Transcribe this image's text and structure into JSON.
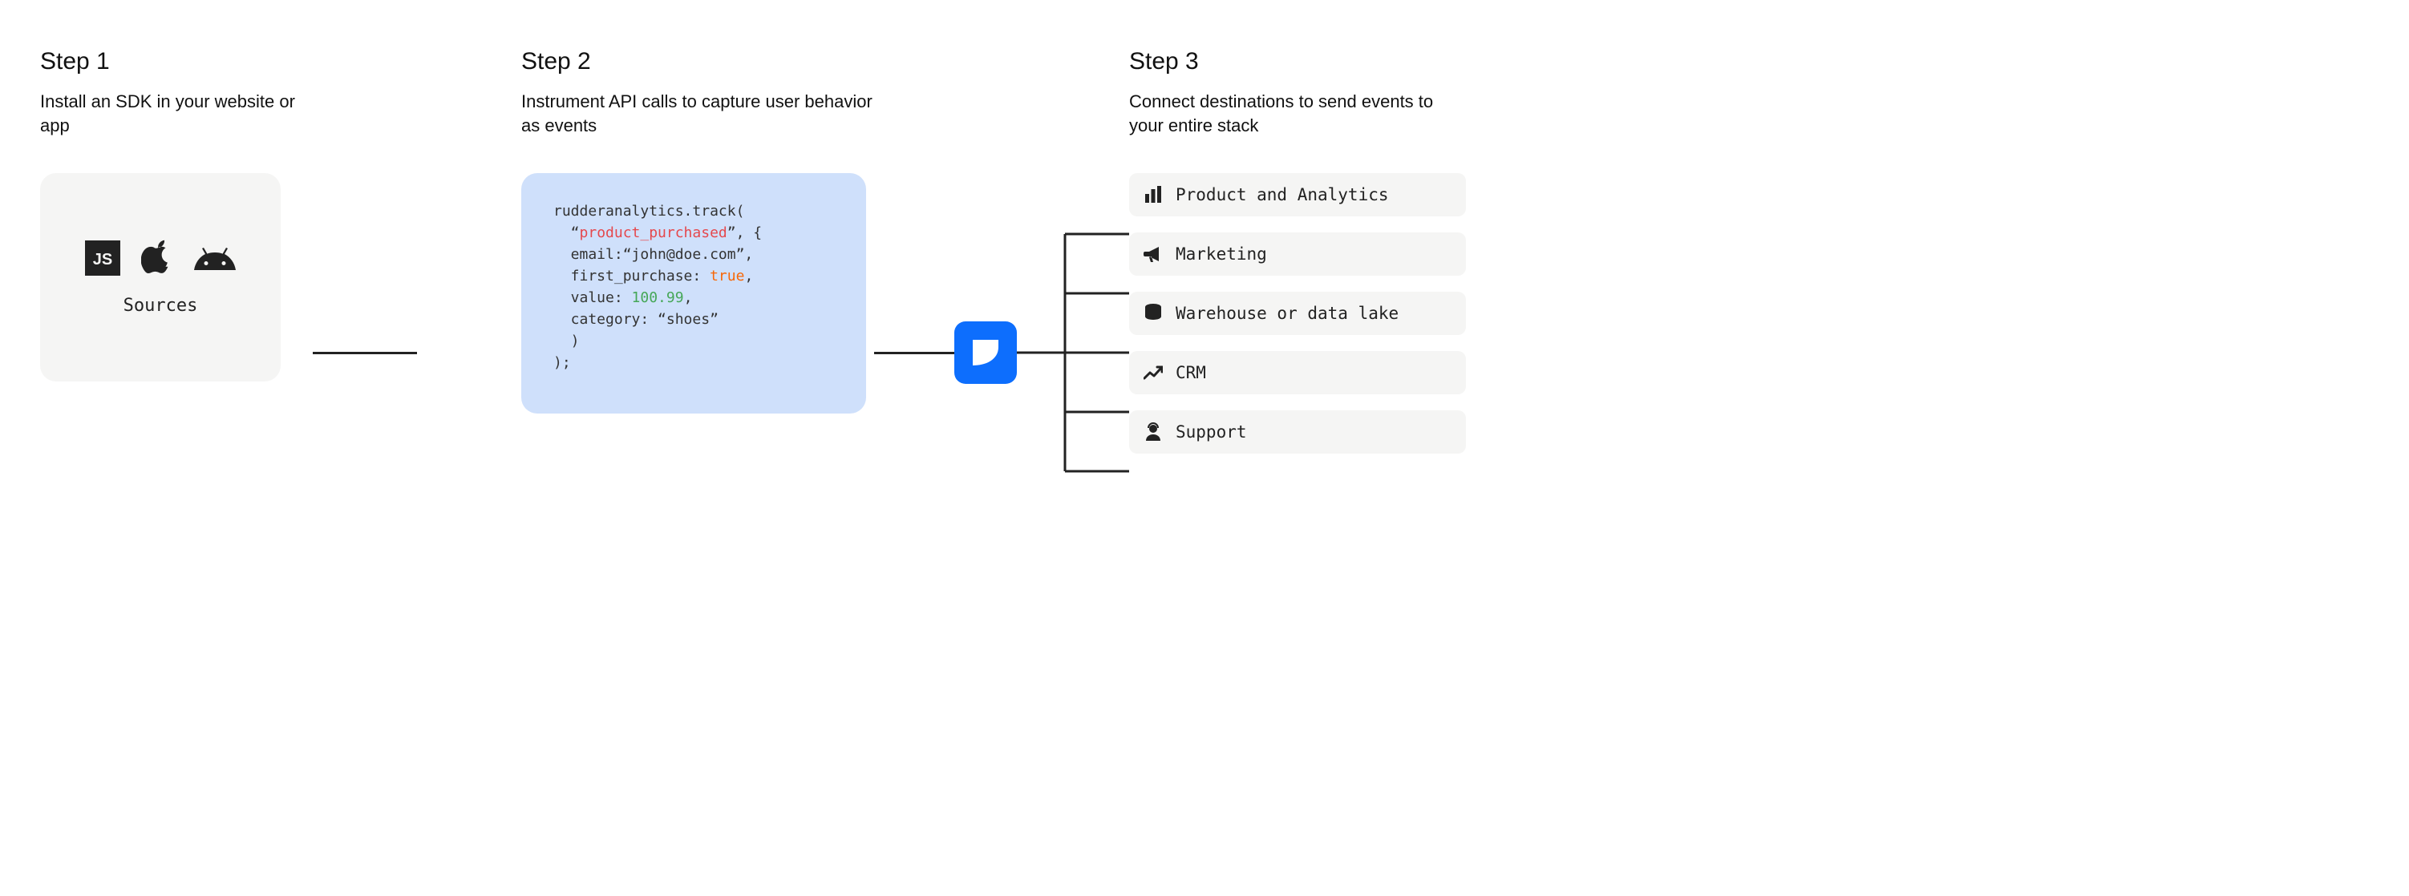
{
  "steps": {
    "s1": {
      "title": "Step 1",
      "desc": "Install an SDK in your website or app"
    },
    "s2": {
      "title": "Step 2",
      "desc": "Instrument API calls to capture user behavior as events"
    },
    "s3": {
      "title": "Step 3",
      "desc": "Connect destinations to send events to your entire stack"
    }
  },
  "sources": {
    "label": "Sources",
    "icons": [
      "javascript-icon",
      "apple-icon",
      "android-icon"
    ]
  },
  "code": {
    "l1": "rudderanalytics.track(",
    "l2a": "  “",
    "l2b": "product_purchased",
    "l2c": "”, {",
    "l3": "  email:“john@doe.com”,",
    "l4a": "  first_purchase: ",
    "l4b": "true",
    "l4c": ",",
    "l5a": "  value: ",
    "l5b": "100.99",
    "l5c": ",",
    "l6": "  category: “shoes”",
    "l7": "  )",
    "l8": ");"
  },
  "destinations": [
    {
      "icon": "chart-bar-icon",
      "label": "Product and Analytics"
    },
    {
      "icon": "megaphone-icon",
      "label": "Marketing"
    },
    {
      "icon": "database-icon",
      "label": "Warehouse or data lake"
    },
    {
      "icon": "trend-up-icon",
      "label": "CRM"
    },
    {
      "icon": "headset-icon",
      "label": "Support"
    }
  ],
  "colors": {
    "brand": "#0d6efd",
    "card_light": "#f5f5f4",
    "card_code": "#cfe0fb"
  }
}
